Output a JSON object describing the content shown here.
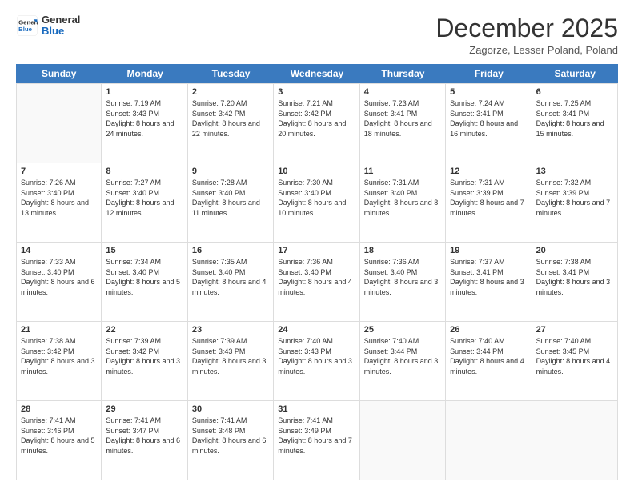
{
  "logo": {
    "line1": "General",
    "line2": "Blue"
  },
  "header": {
    "title": "December 2025",
    "location": "Zagorze, Lesser Poland, Poland"
  },
  "weekdays": [
    "Sunday",
    "Monday",
    "Tuesday",
    "Wednesday",
    "Thursday",
    "Friday",
    "Saturday"
  ],
  "weeks": [
    [
      {
        "day": "",
        "empty": true
      },
      {
        "day": "1",
        "sunrise": "Sunrise: 7:19 AM",
        "sunset": "Sunset: 3:43 PM",
        "daylight": "Daylight: 8 hours and 24 minutes."
      },
      {
        "day": "2",
        "sunrise": "Sunrise: 7:20 AM",
        "sunset": "Sunset: 3:42 PM",
        "daylight": "Daylight: 8 hours and 22 minutes."
      },
      {
        "day": "3",
        "sunrise": "Sunrise: 7:21 AM",
        "sunset": "Sunset: 3:42 PM",
        "daylight": "Daylight: 8 hours and 20 minutes."
      },
      {
        "day": "4",
        "sunrise": "Sunrise: 7:23 AM",
        "sunset": "Sunset: 3:41 PM",
        "daylight": "Daylight: 8 hours and 18 minutes."
      },
      {
        "day": "5",
        "sunrise": "Sunrise: 7:24 AM",
        "sunset": "Sunset: 3:41 PM",
        "daylight": "Daylight: 8 hours and 16 minutes."
      },
      {
        "day": "6",
        "sunrise": "Sunrise: 7:25 AM",
        "sunset": "Sunset: 3:41 PM",
        "daylight": "Daylight: 8 hours and 15 minutes."
      }
    ],
    [
      {
        "day": "7",
        "sunrise": "Sunrise: 7:26 AM",
        "sunset": "Sunset: 3:40 PM",
        "daylight": "Daylight: 8 hours and 13 minutes."
      },
      {
        "day": "8",
        "sunrise": "Sunrise: 7:27 AM",
        "sunset": "Sunset: 3:40 PM",
        "daylight": "Daylight: 8 hours and 12 minutes."
      },
      {
        "day": "9",
        "sunrise": "Sunrise: 7:28 AM",
        "sunset": "Sunset: 3:40 PM",
        "daylight": "Daylight: 8 hours and 11 minutes."
      },
      {
        "day": "10",
        "sunrise": "Sunrise: 7:30 AM",
        "sunset": "Sunset: 3:40 PM",
        "daylight": "Daylight: 8 hours and 10 minutes."
      },
      {
        "day": "11",
        "sunrise": "Sunrise: 7:31 AM",
        "sunset": "Sunset: 3:40 PM",
        "daylight": "Daylight: 8 hours and 8 minutes."
      },
      {
        "day": "12",
        "sunrise": "Sunrise: 7:31 AM",
        "sunset": "Sunset: 3:39 PM",
        "daylight": "Daylight: 8 hours and 7 minutes."
      },
      {
        "day": "13",
        "sunrise": "Sunrise: 7:32 AM",
        "sunset": "Sunset: 3:39 PM",
        "daylight": "Daylight: 8 hours and 7 minutes."
      }
    ],
    [
      {
        "day": "14",
        "sunrise": "Sunrise: 7:33 AM",
        "sunset": "Sunset: 3:40 PM",
        "daylight": "Daylight: 8 hours and 6 minutes."
      },
      {
        "day": "15",
        "sunrise": "Sunrise: 7:34 AM",
        "sunset": "Sunset: 3:40 PM",
        "daylight": "Daylight: 8 hours and 5 minutes."
      },
      {
        "day": "16",
        "sunrise": "Sunrise: 7:35 AM",
        "sunset": "Sunset: 3:40 PM",
        "daylight": "Daylight: 8 hours and 4 minutes."
      },
      {
        "day": "17",
        "sunrise": "Sunrise: 7:36 AM",
        "sunset": "Sunset: 3:40 PM",
        "daylight": "Daylight: 8 hours and 4 minutes."
      },
      {
        "day": "18",
        "sunrise": "Sunrise: 7:36 AM",
        "sunset": "Sunset: 3:40 PM",
        "daylight": "Daylight: 8 hours and 3 minutes."
      },
      {
        "day": "19",
        "sunrise": "Sunrise: 7:37 AM",
        "sunset": "Sunset: 3:41 PM",
        "daylight": "Daylight: 8 hours and 3 minutes."
      },
      {
        "day": "20",
        "sunrise": "Sunrise: 7:38 AM",
        "sunset": "Sunset: 3:41 PM",
        "daylight": "Daylight: 8 hours and 3 minutes."
      }
    ],
    [
      {
        "day": "21",
        "sunrise": "Sunrise: 7:38 AM",
        "sunset": "Sunset: 3:42 PM",
        "daylight": "Daylight: 8 hours and 3 minutes."
      },
      {
        "day": "22",
        "sunrise": "Sunrise: 7:39 AM",
        "sunset": "Sunset: 3:42 PM",
        "daylight": "Daylight: 8 hours and 3 minutes."
      },
      {
        "day": "23",
        "sunrise": "Sunrise: 7:39 AM",
        "sunset": "Sunset: 3:43 PM",
        "daylight": "Daylight: 8 hours and 3 minutes."
      },
      {
        "day": "24",
        "sunrise": "Sunrise: 7:40 AM",
        "sunset": "Sunset: 3:43 PM",
        "daylight": "Daylight: 8 hours and 3 minutes."
      },
      {
        "day": "25",
        "sunrise": "Sunrise: 7:40 AM",
        "sunset": "Sunset: 3:44 PM",
        "daylight": "Daylight: 8 hours and 3 minutes."
      },
      {
        "day": "26",
        "sunrise": "Sunrise: 7:40 AM",
        "sunset": "Sunset: 3:44 PM",
        "daylight": "Daylight: 8 hours and 4 minutes."
      },
      {
        "day": "27",
        "sunrise": "Sunrise: 7:40 AM",
        "sunset": "Sunset: 3:45 PM",
        "daylight": "Daylight: 8 hours and 4 minutes."
      }
    ],
    [
      {
        "day": "28",
        "sunrise": "Sunrise: 7:41 AM",
        "sunset": "Sunset: 3:46 PM",
        "daylight": "Daylight: 8 hours and 5 minutes."
      },
      {
        "day": "29",
        "sunrise": "Sunrise: 7:41 AM",
        "sunset": "Sunset: 3:47 PM",
        "daylight": "Daylight: 8 hours and 6 minutes."
      },
      {
        "day": "30",
        "sunrise": "Sunrise: 7:41 AM",
        "sunset": "Sunset: 3:48 PM",
        "daylight": "Daylight: 8 hours and 6 minutes."
      },
      {
        "day": "31",
        "sunrise": "Sunrise: 7:41 AM",
        "sunset": "Sunset: 3:49 PM",
        "daylight": "Daylight: 8 hours and 7 minutes."
      },
      {
        "day": "",
        "empty": true
      },
      {
        "day": "",
        "empty": true
      },
      {
        "day": "",
        "empty": true
      }
    ]
  ]
}
